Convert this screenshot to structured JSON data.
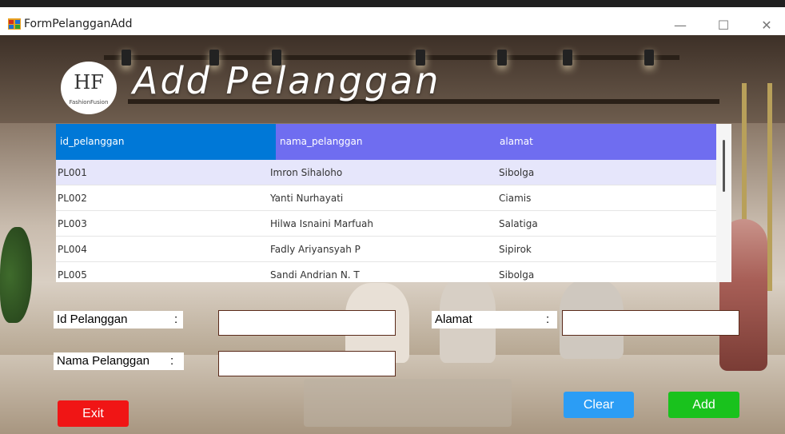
{
  "window": {
    "title": "FormPelangganAdd",
    "controls": {
      "minimize": "—",
      "maximize": "☐",
      "close": "✕"
    }
  },
  "logo": {
    "mark": "HF",
    "text": "FashionFusion"
  },
  "heading": "Add Pelanggan",
  "grid": {
    "columns": [
      "id_pelanggan",
      "nama_pelanggan",
      "alamat"
    ],
    "rows": [
      [
        "PL001",
        "Imron Sihaloho",
        "Sibolga"
      ],
      [
        "PL002",
        "Yanti Nurhayati",
        "Ciamis"
      ],
      [
        "PL003",
        "Hilwa Isnaini Marfuah",
        "Salatiga"
      ],
      [
        "PL004",
        "Fadly Ariyansyah P",
        "Sipirok"
      ],
      [
        "PL005",
        "Sandi Andrian N. T",
        "Sibolga"
      ]
    ],
    "selected_row": 0
  },
  "form": {
    "id_label": "Id Pelanggan",
    "nama_label": "Nama Pelanggan",
    "alamat_label": "Alamat",
    "colon": ":",
    "id_value": "",
    "nama_value": "",
    "alamat_value": ""
  },
  "buttons": {
    "exit": "Exit",
    "clear": "Clear",
    "add": "Add"
  },
  "colors": {
    "header_id": "#0078d7",
    "header_other": "#6f6df0",
    "exit": "#f01515",
    "clear": "#2b9df5",
    "add": "#19c21d"
  }
}
